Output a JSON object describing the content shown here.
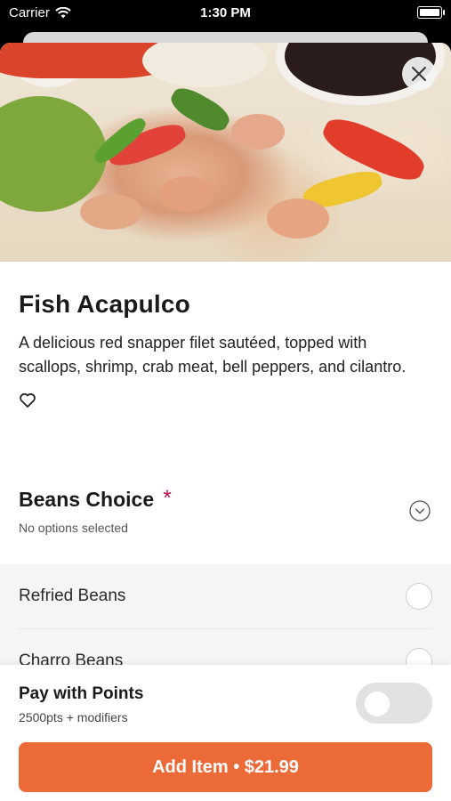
{
  "status_bar": {
    "carrier": "Carrier",
    "time": "1:30 PM"
  },
  "item": {
    "title": "Fish Acapulco",
    "description": "A delicious red snapper filet sautéed, topped with scallops, shrimp, crab meat, bell peppers, and cilantro."
  },
  "beans_choice": {
    "title": "Beans Choice",
    "required_mark": "*",
    "subtitle": "No options selected",
    "options": [
      {
        "label": "Refried Beans"
      },
      {
        "label": "Charro Beans"
      }
    ]
  },
  "pay_with_points": {
    "title": "Pay with Points",
    "subtitle": "2500pts + modifiers",
    "enabled": false
  },
  "add_button": {
    "label": "Add Item • $21.99"
  },
  "colors": {
    "accent": "#ec6a37",
    "required": "#c0134d"
  },
  "icons": [
    "wifi-icon",
    "battery-icon",
    "close-icon",
    "heart-icon",
    "chevron-down-icon",
    "radio-icon"
  ]
}
